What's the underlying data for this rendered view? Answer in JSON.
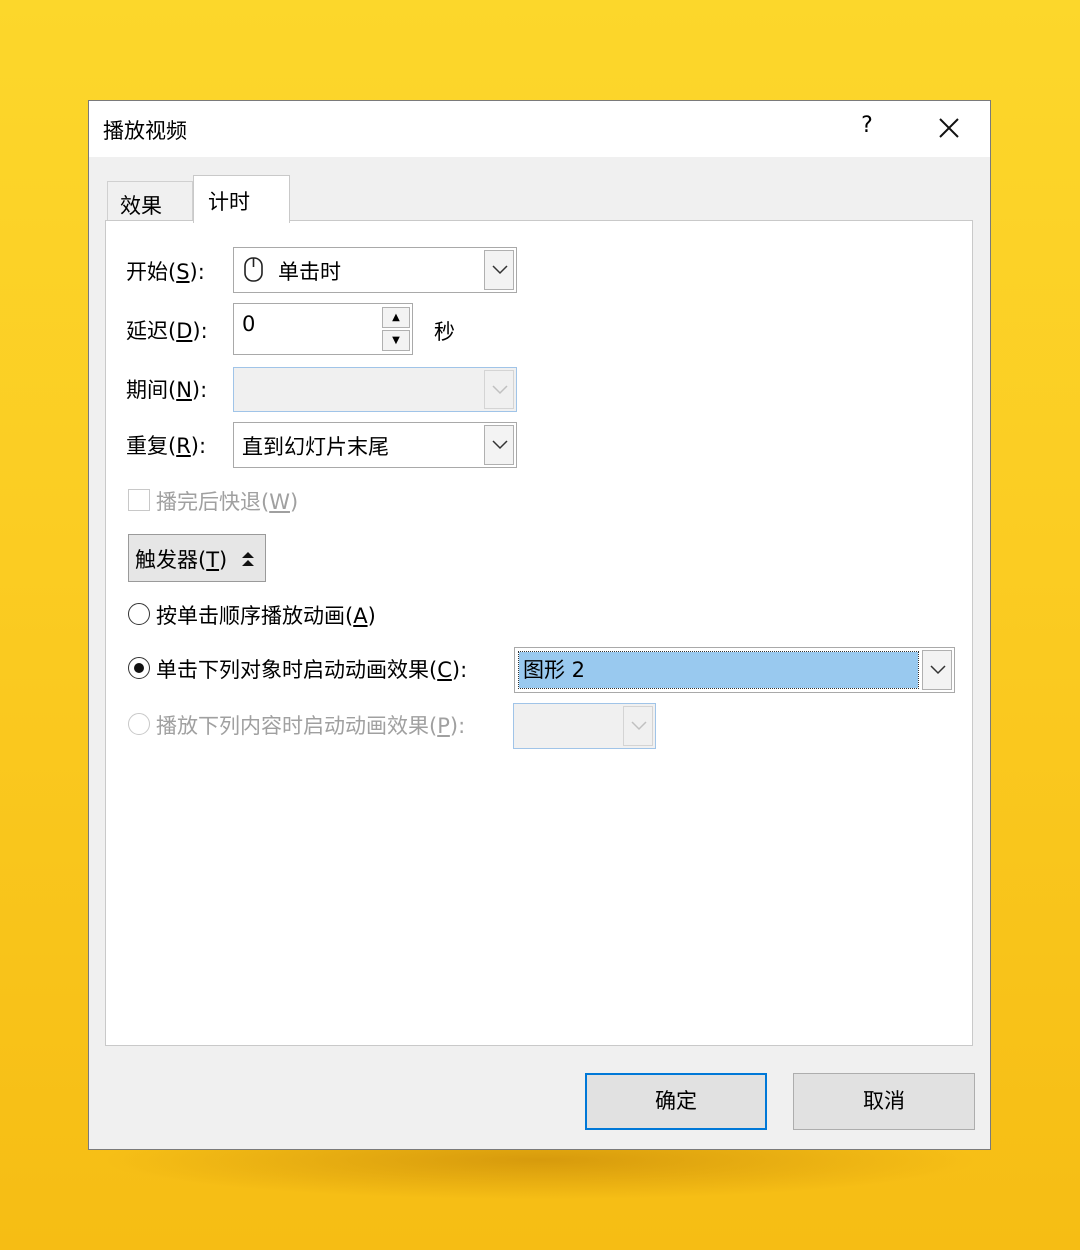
{
  "dialog": {
    "title": "播放视频",
    "help": "?"
  },
  "tabs": [
    {
      "label": "效果",
      "active": false
    },
    {
      "label": "计时",
      "active": true
    }
  ],
  "start": {
    "label": "开始(",
    "key": "S",
    "suffix": "):",
    "value": "单击时",
    "icon": "mouse-icon"
  },
  "delay": {
    "label": "延迟(",
    "key": "D",
    "suffix": "):",
    "value": "0",
    "unit": "秒"
  },
  "duration": {
    "label": "期间(",
    "key": "N",
    "suffix": "):",
    "value": ""
  },
  "repeat": {
    "label": "重复(",
    "key": "R",
    "suffix": "):",
    "value": "直到幻灯片末尾"
  },
  "rewind": {
    "label": "播完后快退(",
    "key": "W",
    "suffix": ")",
    "checked": false
  },
  "triggers": {
    "button_label": "触发器(",
    "button_key": "T",
    "button_suffix": ")",
    "option_sequence": {
      "label": "按单击顺序播放动画(",
      "key": "A",
      "suffix": ")",
      "selected": false
    },
    "option_click": {
      "label": "单击下列对象时启动动画效果(",
      "key": "C",
      "suffix": "):",
      "selected": true,
      "value": "图形 2"
    },
    "option_play": {
      "label": "播放下列内容时启动动画效果(",
      "key": "P",
      "suffix": "):",
      "selected": false,
      "value": ""
    }
  },
  "buttons": {
    "ok": "确定",
    "cancel": "取消"
  },
  "colors": {
    "accent": "#0078d7",
    "selection": "#99c9ef",
    "background": "#fbcc22"
  }
}
